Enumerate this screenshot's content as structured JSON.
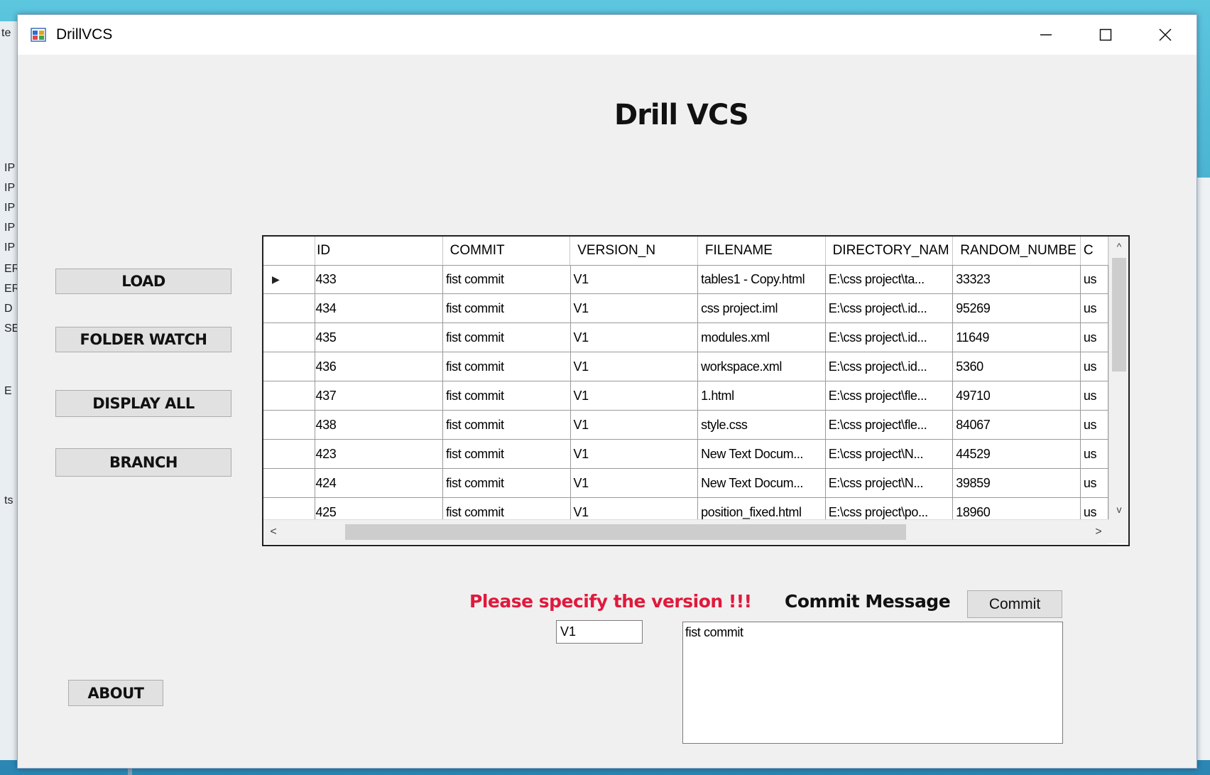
{
  "window": {
    "title": "DrillVCS",
    "controls": {
      "minimize": "—",
      "maximize": "☐",
      "close": "✕"
    }
  },
  "background_fragments": {
    "top_left": "te",
    "left_edge": [
      "IP",
      "IP",
      "IP",
      "IP",
      "IP",
      "ER",
      "ER",
      "D",
      "SE",
      "E",
      "ts"
    ]
  },
  "heading": "Drill VCS",
  "sidebar": {
    "load": "LOAD",
    "folder_watch": "FOLDER WATCH",
    "display_all": "DISPLAY ALL",
    "branch": "BRANCH",
    "about": "ABOUT"
  },
  "grid": {
    "columns": [
      "ID",
      "COMMIT",
      "VERSION_N",
      "FILENAME",
      "DIRECTORY_NAM",
      "RANDOM_NUMBE",
      "C"
    ],
    "rows": [
      {
        "id": "433",
        "commit": "fist commit",
        "version": "V1",
        "filename": "tables1 - Copy.html",
        "directory": "E:\\css project\\ta...",
        "random": "33323",
        "c": "us",
        "current": true
      },
      {
        "id": "434",
        "commit": "fist commit",
        "version": "V1",
        "filename": "css project.iml",
        "directory": "E:\\css project\\.id...",
        "random": "95269",
        "c": "us"
      },
      {
        "id": "435",
        "commit": "fist commit",
        "version": "V1",
        "filename": "modules.xml",
        "directory": "E:\\css project\\.id...",
        "random": "11649",
        "c": "us"
      },
      {
        "id": "436",
        "commit": "fist commit",
        "version": "V1",
        "filename": "workspace.xml",
        "directory": "E:\\css project\\.id...",
        "random": "5360",
        "c": "us"
      },
      {
        "id": "437",
        "commit": "fist commit",
        "version": "V1",
        "filename": "1.html",
        "directory": "E:\\css project\\fle...",
        "random": "49710",
        "c": "us"
      },
      {
        "id": "438",
        "commit": "fist commit",
        "version": "V1",
        "filename": "style.css",
        "directory": "E:\\css project\\fle...",
        "random": "84067",
        "c": "us"
      },
      {
        "id": "423",
        "commit": "fist commit",
        "version": "V1",
        "filename": "New Text Docum...",
        "directory": "E:\\css project\\N...",
        "random": "44529",
        "c": "us"
      },
      {
        "id": "424",
        "commit": "fist commit",
        "version": "V1",
        "filename": "New Text Docum...",
        "directory": "E:\\css project\\N...",
        "random": "39859",
        "c": "us"
      },
      {
        "id": "425",
        "commit": "fist commit",
        "version": "V1",
        "filename": "position_fixed.html",
        "directory": "E:\\css project\\po...",
        "random": "18960",
        "c": "us"
      }
    ]
  },
  "form": {
    "warning": "Please specify the version !!!",
    "commit_label": "Commit Message",
    "commit_button": "Commit",
    "version_value": "V1",
    "commit_message": "fist commit"
  },
  "colors": {
    "warning": "#e0193c",
    "window_bg": "#f0f0f0"
  }
}
